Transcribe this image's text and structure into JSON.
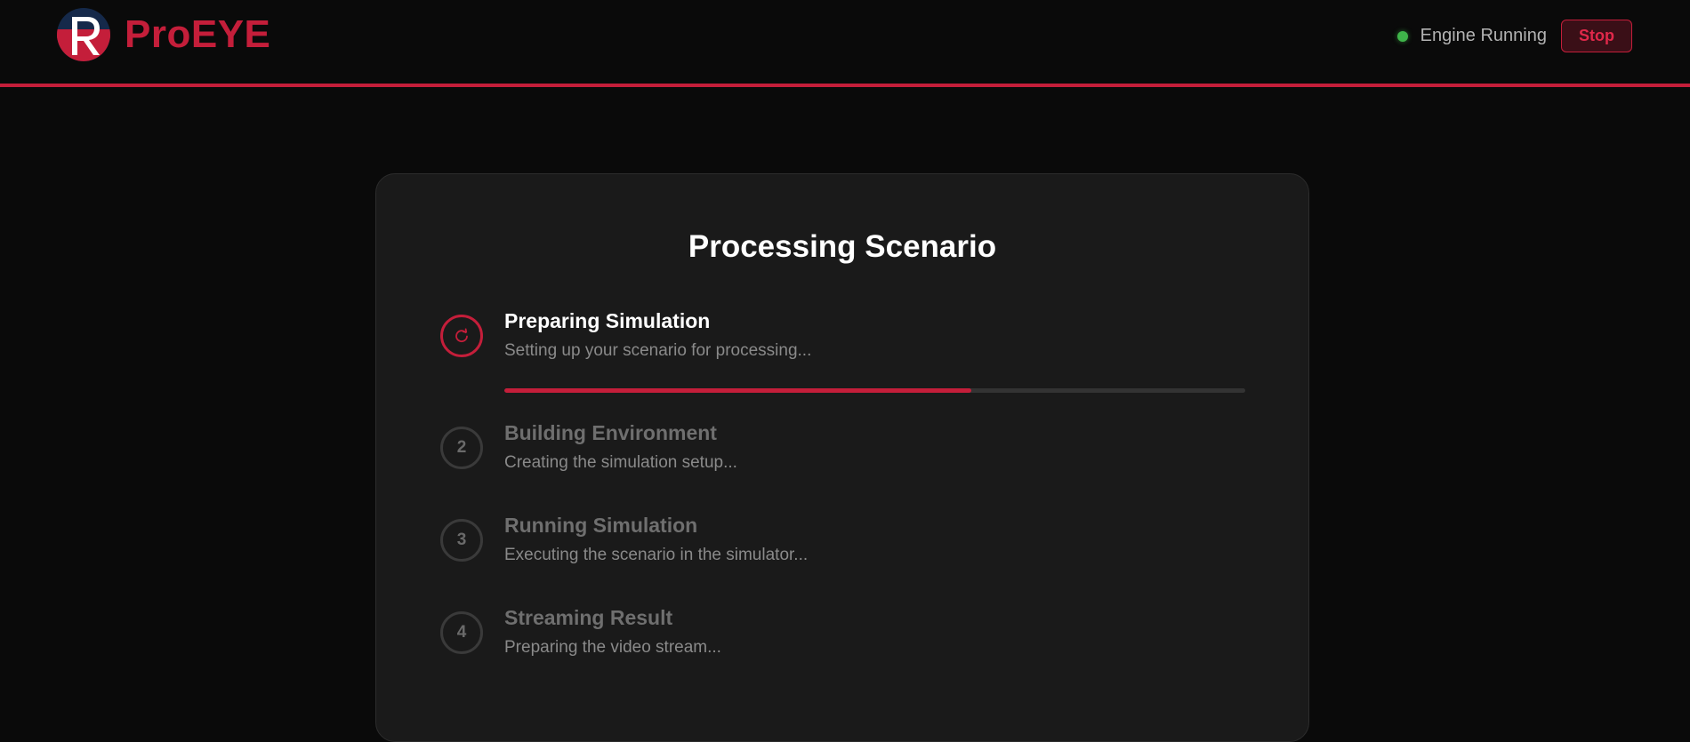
{
  "header": {
    "brand": "ProEYE",
    "status_text": "Engine Running",
    "stop_label": "Stop"
  },
  "colors": {
    "accent": "#c41e3a",
    "status_ok": "#3fb54a",
    "background": "#0a0a0a",
    "card": "#1a1a1a"
  },
  "main": {
    "title": "Processing Scenario",
    "steps": [
      {
        "number": "",
        "icon": "refresh-icon",
        "title": "Preparing Simulation",
        "description": "Setting up your scenario for processing...",
        "active": true,
        "progress": 0.63
      },
      {
        "number": "2",
        "title": "Building Environment",
        "description": "Creating the simulation setup...",
        "active": false
      },
      {
        "number": "3",
        "title": "Running Simulation",
        "description": "Executing the scenario in the simulator...",
        "active": false
      },
      {
        "number": "4",
        "title": "Streaming Result",
        "description": "Preparing the video stream...",
        "active": false
      }
    ]
  }
}
